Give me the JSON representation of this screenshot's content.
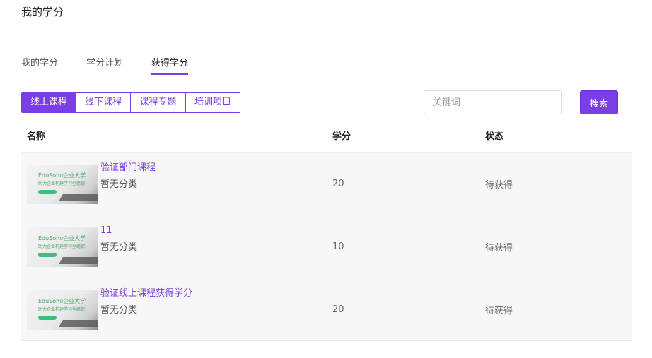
{
  "header": {
    "title": "我的学分"
  },
  "tabs": [
    {
      "label": "我的学分",
      "active": false
    },
    {
      "label": "学分计划",
      "active": false
    },
    {
      "label": "获得学分",
      "active": true
    }
  ],
  "filter": {
    "segments": [
      "线上课程",
      "线下课程",
      "课程专题",
      "培训项目"
    ],
    "active_segment": "线上课程",
    "search": {
      "placeholder": "关键词",
      "value": "",
      "button_label": "搜索"
    }
  },
  "table": {
    "columns": [
      "名称",
      "学分",
      "状态"
    ],
    "rows": [
      {
        "title": "验证部门课程",
        "category": "暂无分类",
        "credit": "20",
        "status": "待获得"
      },
      {
        "title": "11",
        "category": "暂无分类",
        "credit": "10",
        "status": "待获得"
      },
      {
        "title": "验证线上课程获得学分",
        "category": "暂无分类",
        "credit": "20",
        "status": "待获得"
      }
    ],
    "thumbnail": {
      "line1": "EduSoho企业大学",
      "line2": "助力企业构建学习型组织"
    }
  },
  "colors": {
    "accent": "#7a3ee6",
    "row_bg": "#f7f7f7"
  }
}
